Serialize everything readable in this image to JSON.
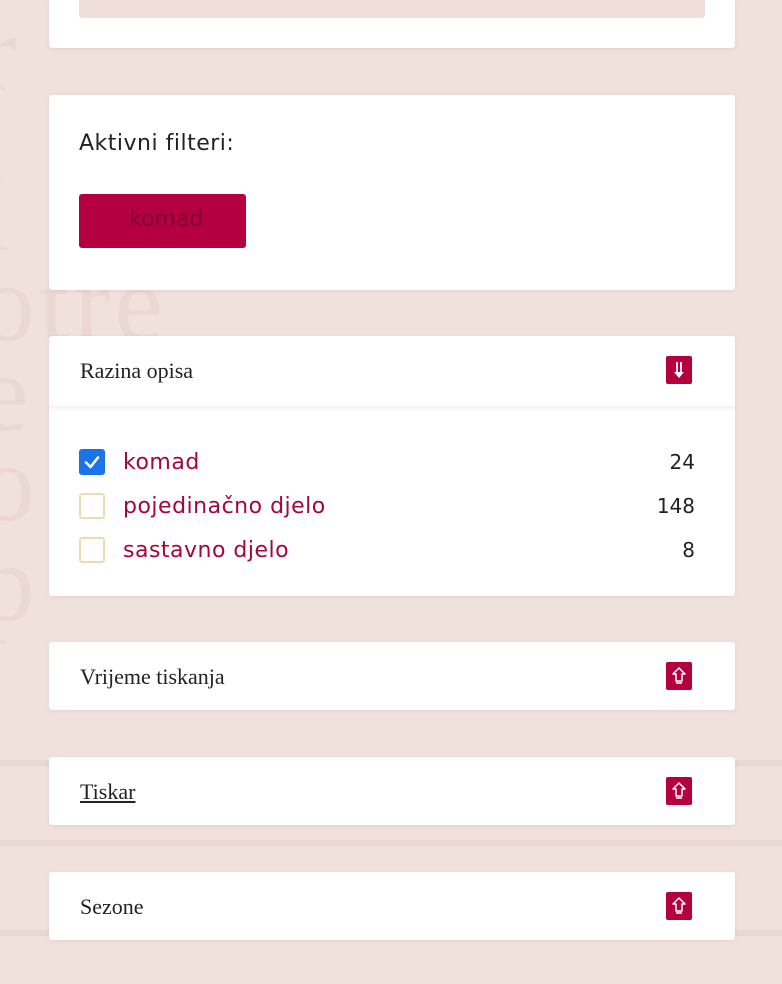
{
  "active_filters": {
    "title": "Aktivni filteri:",
    "chips": [
      {
        "label": "komad"
      }
    ]
  },
  "facets": [
    {
      "title": "Razina opisa",
      "expanded": true,
      "toggle_icon": "collapse-arrow-down-icon",
      "items": [
        {
          "label": "komad",
          "count": "24",
          "checked": true
        },
        {
          "label": "pojedinačno djelo",
          "count": "148",
          "checked": false
        },
        {
          "label": "sastavno djelo",
          "count": "8",
          "checked": false
        }
      ]
    },
    {
      "title": "Vrijeme tiskanja",
      "expanded": false,
      "toggle_icon": "expand-arrow-up-icon"
    },
    {
      "title": "Tiskar",
      "expanded": false,
      "toggle_icon": "expand-arrow-up-icon"
    },
    {
      "title": "Sezone",
      "expanded": false,
      "toggle_icon": "expand-arrow-up-icon"
    }
  ],
  "colors": {
    "accent": "#b5003f",
    "label": "#a4063e",
    "checkbox_checked": "#1a73e8",
    "checkbox_border": "#ecdcaf",
    "background": "#f1e1dd"
  }
}
